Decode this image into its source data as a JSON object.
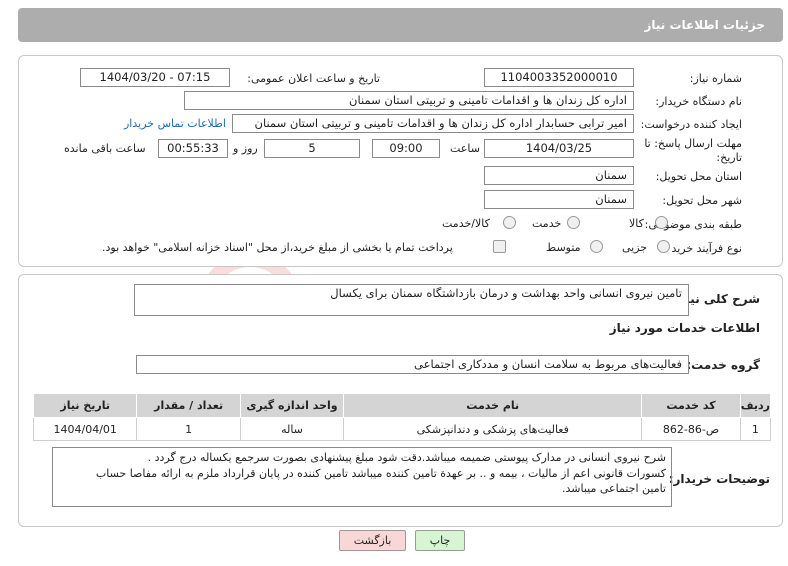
{
  "header": {
    "title": "جزئیات اطلاعات نیاز"
  },
  "form": {
    "need_number_label": "شماره نیاز:",
    "need_number": "1104003352000010",
    "announce_label": "تاریخ و ساعت اعلان عمومی:",
    "announce_value": "1404/03/20 - 07:15",
    "buyer_org_label": "نام دستگاه خریدار:",
    "buyer_org": "اداره کل زندان ها و اقدامات تامینی و تربیتی استان سمنان",
    "creator_label": "ایجاد کننده درخواست:",
    "creator": "امیر ترابی حسابدار اداره کل زندان ها و اقدامات تامینی و تربیتی استان سمنان",
    "contact_link": "اطلاعات تماس خریدار",
    "deadline_label_1": "مهلت ارسال پاسخ: تا",
    "deadline_label_2": "تاریخ:",
    "deadline_date": "1404/03/25",
    "time_label": "ساعت",
    "deadline_time": "09:00",
    "days_value": "5",
    "days_label": "روز و",
    "remaining_time": "00:55:33",
    "remaining_label": "ساعت باقی مانده",
    "province_label": "استان محل تحویل:",
    "province": "سمنان",
    "city_label": "شهر محل تحویل:",
    "city": "سمنان",
    "category_label": "طبقه بندی موضوعی:",
    "category_options": [
      "کالا",
      "خدمت",
      "کالا/خدمت"
    ],
    "category_selected": "خدمت",
    "process_label": "نوع فرآیند خرید :",
    "process_options": [
      "جزیی",
      "متوسط"
    ],
    "payment_note": "پرداخت تمام یا بخشی از مبلغ خرید،از محل \"اسناد خزانه اسلامی\" خواهد بود."
  },
  "summary": {
    "label": "شرح کلی نیاز:",
    "value": "تامین نیروی انسانی واحد بهداشت و درمان بازداشتگاه سمنان برای یکسال"
  },
  "services": {
    "section_title": "اطلاعات خدمات مورد نیاز",
    "group_label": "گروه خدمت:",
    "group_value": "فعالیت‌های مربوط به سلامت انسان و مددکاری اجتماعی",
    "columns": [
      "ردیف",
      "کد خدمت",
      "نام خدمت",
      "واحد اندازه گیری",
      "تعداد / مقدار",
      "تاریخ نیاز"
    ],
    "rows": [
      [
        "1",
        "ص-86-862",
        "فعالیت‌های پزشکی و دندانپزشکی",
        "ساله",
        "1",
        "1404/04/01"
      ]
    ]
  },
  "buyer_notes": {
    "label": "توضیحات خریدار:",
    "lines": [
      "شرح نیروی انسانی در مدارک پیوستی ضمیمه میباشد.دقت شود مبلغ پیشنهادی بصورت سرجمع یکساله درج گردد .",
      "کسورات قانونی اعم از مالیات ، بیمه و .. بر عهدة تامین کننده میباشد تامین کننده در پایان قرارداد ملزم به ارائه مفاصا حساب",
      "تامین اجتماعی میباشد."
    ]
  },
  "buttons": {
    "print": "چاپ",
    "back": "بازگشت"
  },
  "colors": {
    "header_bg": "#adadad",
    "link": "#1a6bb8",
    "print_bg": "#d8f5d3",
    "back_bg": "#f9d7d7"
  }
}
